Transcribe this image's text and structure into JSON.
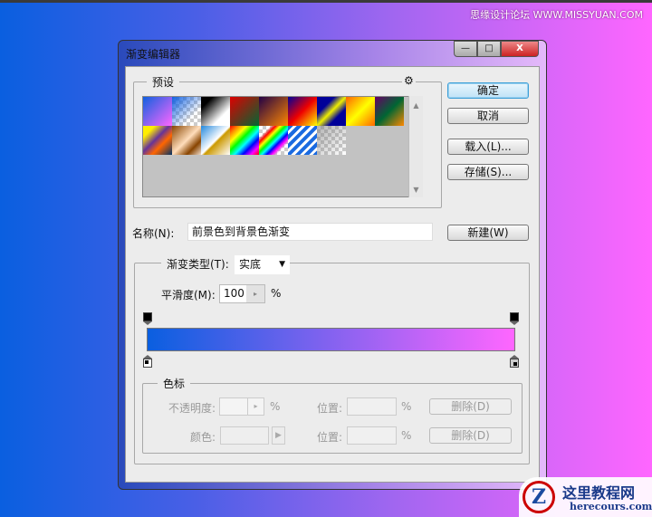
{
  "watermark_top": "思缘设计论坛 WWW.MISSYUAN.COM",
  "watermark_bottom": {
    "title": "这里教程网",
    "url": "herecours.com"
  },
  "dialog": {
    "title": "渐变编辑器",
    "window_buttons": {
      "minimize": "—",
      "maximize": "□",
      "close": "X"
    },
    "presets": {
      "label": "预设",
      "gear": "⚙",
      "scroll_up": "▲",
      "scroll_down": "▼"
    },
    "buttons": {
      "ok": "确定",
      "cancel": "取消",
      "load": "载入(L)...",
      "save": "存储(S)...",
      "new": "新建(W)"
    },
    "name": {
      "label": "名称(N):",
      "value": "前景色到背景色渐变"
    },
    "gradient_type": {
      "label": "渐变类型(T):",
      "value": "实底",
      "arrow": "▼"
    },
    "smoothness": {
      "label": "平滑度(M):",
      "value": "100",
      "unit": "%",
      "arrow": "▸"
    },
    "gradient": {
      "start_color": "#0a5fe0",
      "end_color": "#ff66ff"
    },
    "color_stops": {
      "label": "色标",
      "opacity_label": "不透明度:",
      "opacity_unit": "%",
      "opacity_arrow": "▸",
      "color_label": "颜色:",
      "color_arrow": "▶",
      "location_label": "位置:",
      "location_unit": "%",
      "delete": "删除(D)"
    }
  }
}
